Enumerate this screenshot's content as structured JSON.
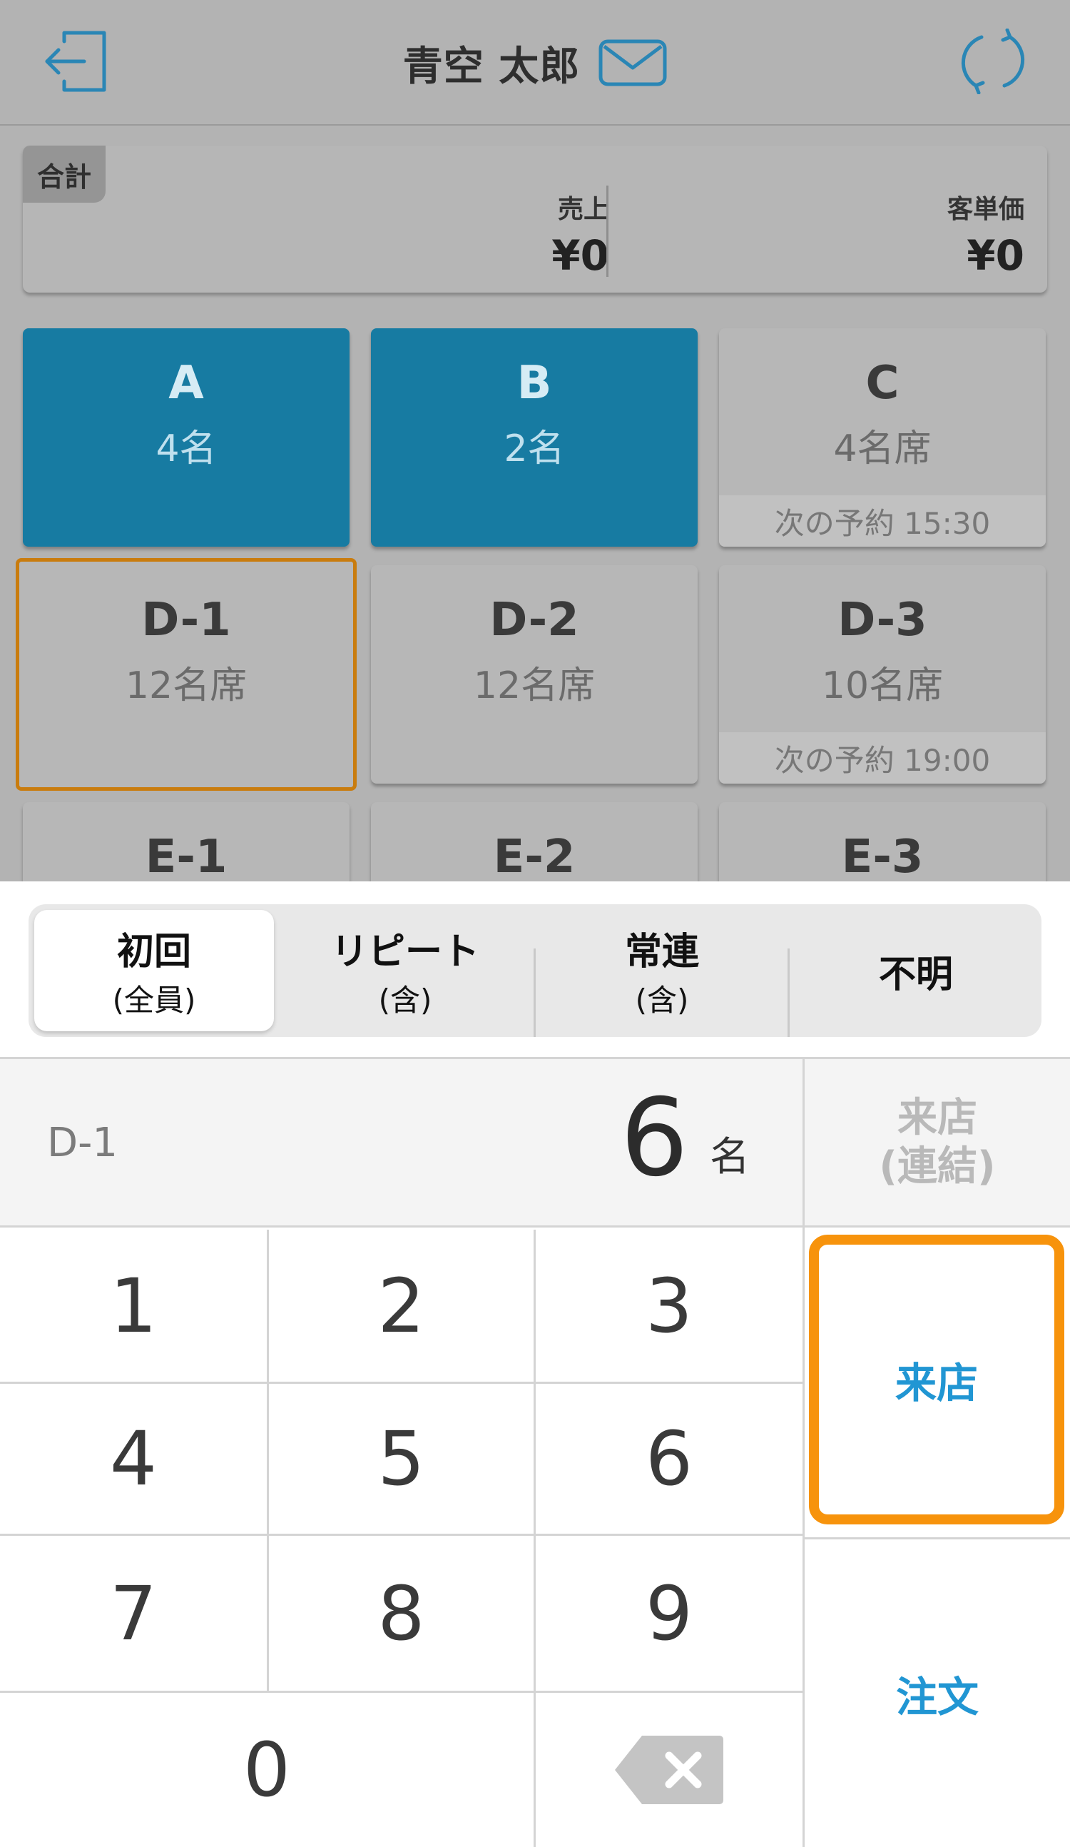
{
  "header": {
    "user_name": "青空 太郎",
    "icons": {
      "left": "logout-icon",
      "mail": "mail-icon",
      "right": "sync-icon"
    }
  },
  "summary": {
    "tag": "合計",
    "sales_label": "売上",
    "sales_value": "¥0",
    "unit_price_label": "客単価",
    "unit_price_value": "¥0"
  },
  "tables": [
    {
      "name": "A",
      "capacity": "4名",
      "status": "occupied"
    },
    {
      "name": "B",
      "capacity": "2名",
      "status": "occupied"
    },
    {
      "name": "C",
      "capacity": "4名席",
      "status": "vacant",
      "next_reservation": "次の予約 15:30"
    },
    {
      "name": "D-1",
      "capacity": "12名席",
      "status": "selected"
    },
    {
      "name": "D-2",
      "capacity": "12名席",
      "status": "vacant"
    },
    {
      "name": "D-3",
      "capacity": "10名席",
      "status": "vacant",
      "next_reservation": "次の予約 19:00"
    },
    {
      "name": "E-1",
      "capacity": "",
      "status": "vacant"
    },
    {
      "name": "E-2",
      "capacity": "",
      "status": "vacant"
    },
    {
      "name": "E-3",
      "capacity": "",
      "status": "vacant"
    }
  ],
  "customer_type": {
    "selected": "初回",
    "options": [
      {
        "main": "初回",
        "sub": "(全員)"
      },
      {
        "main": "リピート",
        "sub": "(含)"
      },
      {
        "main": "常連",
        "sub": "(含)"
      },
      {
        "main": "不明",
        "sub": ""
      }
    ]
  },
  "entry": {
    "table": "D-1",
    "count": "6",
    "unit": "名"
  },
  "keypad": {
    "keys": [
      "1",
      "2",
      "3",
      "4",
      "5",
      "6",
      "7",
      "8",
      "9",
      "0"
    ],
    "delete_icon": "backspace-icon"
  },
  "actions": {
    "visit_linked_line1": "来店",
    "visit_linked_line2": "(連結)",
    "visit": "来店",
    "order": "注文"
  },
  "colors": {
    "occupied": "#177ba2",
    "selected_border": "#c97c0e",
    "highlight": "#f7930c",
    "action_text": "#2196d3"
  }
}
